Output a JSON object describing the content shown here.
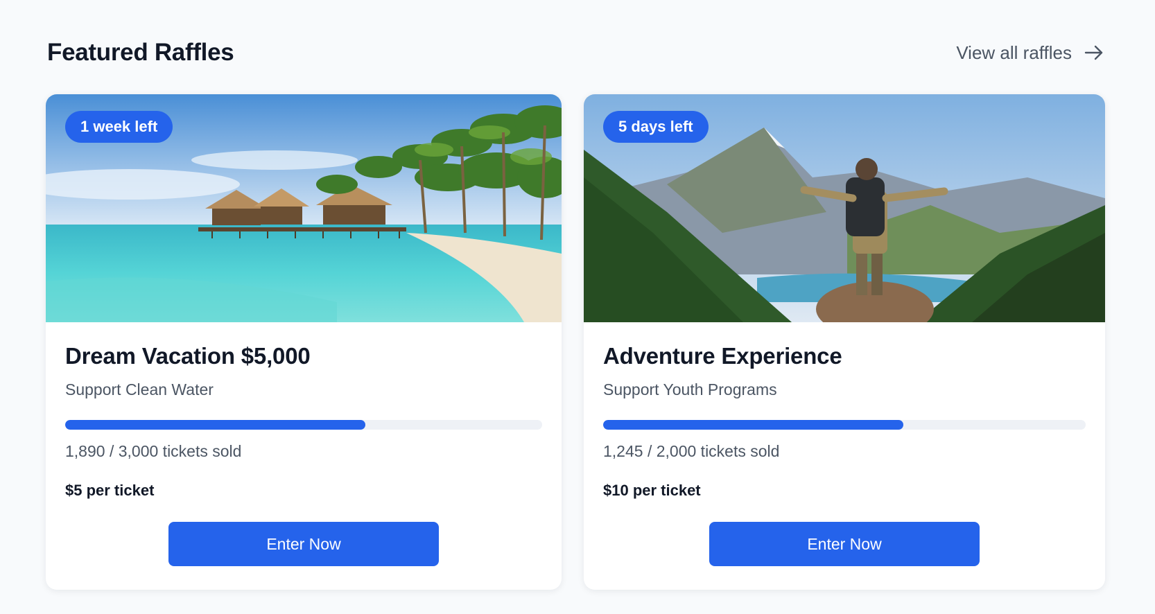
{
  "section": {
    "title": "Featured Raffles",
    "view_all_label": "View all raffles",
    "view_all_icon": "arrow-right-icon"
  },
  "colors": {
    "accent": "#2563eb",
    "background": "#f8fafc",
    "track": "#eef1f6"
  },
  "raffles": [
    {
      "badge": "1 week left",
      "title": "Dream Vacation $5,000",
      "cause": "Support Clean Water",
      "tickets_text": "1,890 / 3,000 tickets sold",
      "sold": 1890,
      "total": 3000,
      "price": "$5 per ticket",
      "button": "Enter Now",
      "image": "tropical-beach-image"
    },
    {
      "badge": "5 days left",
      "title": "Adventure Experience",
      "cause": "Support Youth Programs",
      "tickets_text": "1,245 / 2,000 tickets sold",
      "sold": 1245,
      "total": 2000,
      "price": "$10 per ticket",
      "button": "Enter Now",
      "image": "mountain-hiker-image"
    }
  ]
}
